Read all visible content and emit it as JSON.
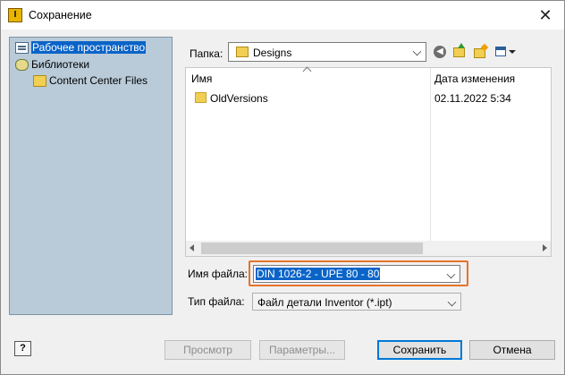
{
  "window": {
    "title": "Сохранение",
    "close_glyph": "✕",
    "app_icon_letter": "I"
  },
  "nav": {
    "items": [
      {
        "label": "Рабочее пространство",
        "icon": "workspace-icon",
        "selected": true
      },
      {
        "label": "Библиотеки",
        "icon": "library-icon",
        "selected": false
      },
      {
        "label": "Content Center Files",
        "icon": "folder-icon",
        "selected": false
      }
    ]
  },
  "folder": {
    "label": "Папка:",
    "value": "Designs"
  },
  "toolbar": {
    "back_glyph": "◀",
    "icons": [
      "back-icon",
      "up-folder-icon",
      "new-folder-icon",
      "view-menu-icon"
    ]
  },
  "file_list": {
    "columns": [
      "Имя",
      "Дата изменения"
    ],
    "rows": [
      {
        "name": "OldVersions",
        "modified": "02.11.2022 5:34",
        "icon": "folder-icon"
      }
    ]
  },
  "filename": {
    "label": "Имя файла:",
    "value": "DIN 1026-2 - UPE 80 - 80"
  },
  "filetype": {
    "label": "Тип файла:",
    "value": "Файл детали Inventor (*.ipt)"
  },
  "buttons": {
    "preview": "Просмотр",
    "options": "Параметры...",
    "save": "Сохранить",
    "cancel": "Отмена",
    "help_glyph": "?"
  },
  "colors": {
    "selection": "#0a64c8",
    "highlight_box": "#e5732a",
    "nav_bg": "#b9cbd9",
    "default_button_border": "#0078d7"
  }
}
